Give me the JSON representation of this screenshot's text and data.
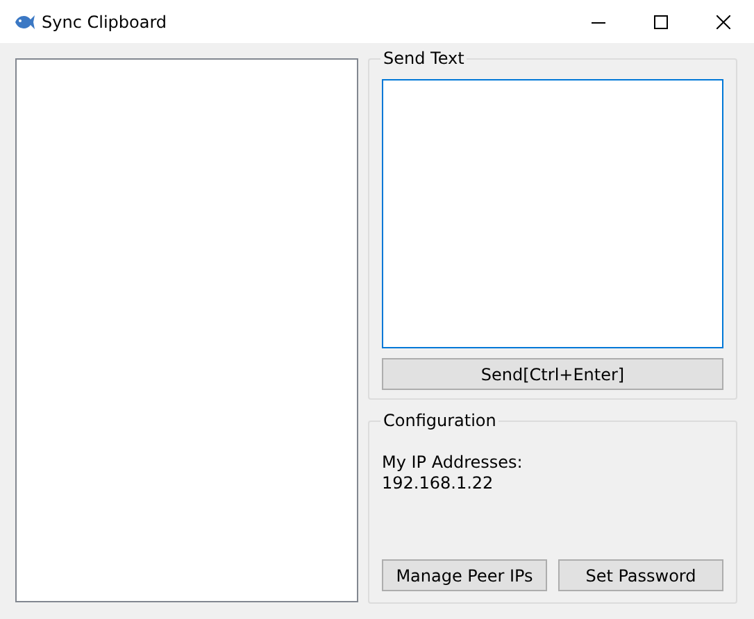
{
  "window": {
    "title": "Sync Clipboard"
  },
  "send_text": {
    "title": "Send Text",
    "text_box": {
      "focused": true
    },
    "button": "Send[Ctrl+Enter]"
  },
  "configuration": {
    "title": "Configuration",
    "ip_label": "My IP Addresses:",
    "ip_value": "192.168.1.22",
    "buttons": [
      "Manage Peer IPs",
      "Set Password"
    ]
  }
}
